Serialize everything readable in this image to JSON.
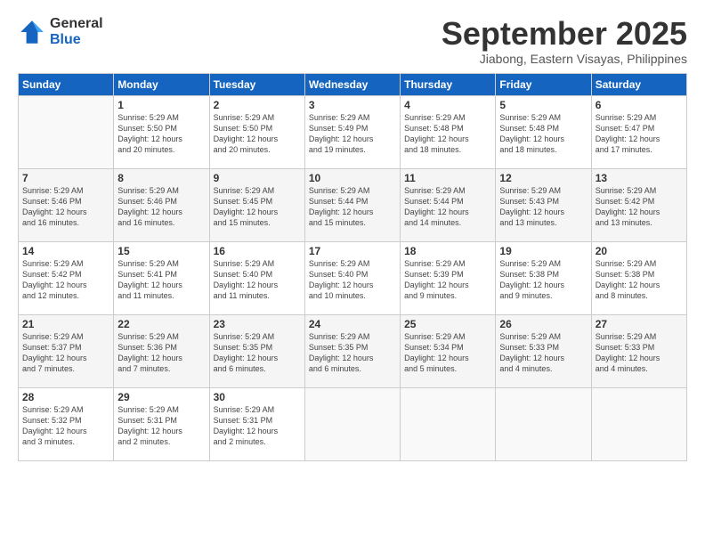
{
  "logo": {
    "general": "General",
    "blue": "Blue"
  },
  "title": "September 2025",
  "location": "Jiabong, Eastern Visayas, Philippines",
  "days_header": [
    "Sunday",
    "Monday",
    "Tuesday",
    "Wednesday",
    "Thursday",
    "Friday",
    "Saturday"
  ],
  "weeks": [
    [
      {
        "num": "",
        "info": ""
      },
      {
        "num": "1",
        "info": "Sunrise: 5:29 AM\nSunset: 5:50 PM\nDaylight: 12 hours\nand 20 minutes."
      },
      {
        "num": "2",
        "info": "Sunrise: 5:29 AM\nSunset: 5:50 PM\nDaylight: 12 hours\nand 20 minutes."
      },
      {
        "num": "3",
        "info": "Sunrise: 5:29 AM\nSunset: 5:49 PM\nDaylight: 12 hours\nand 19 minutes."
      },
      {
        "num": "4",
        "info": "Sunrise: 5:29 AM\nSunset: 5:48 PM\nDaylight: 12 hours\nand 18 minutes."
      },
      {
        "num": "5",
        "info": "Sunrise: 5:29 AM\nSunset: 5:48 PM\nDaylight: 12 hours\nand 18 minutes."
      },
      {
        "num": "6",
        "info": "Sunrise: 5:29 AM\nSunset: 5:47 PM\nDaylight: 12 hours\nand 17 minutes."
      }
    ],
    [
      {
        "num": "7",
        "info": "Sunrise: 5:29 AM\nSunset: 5:46 PM\nDaylight: 12 hours\nand 16 minutes."
      },
      {
        "num": "8",
        "info": "Sunrise: 5:29 AM\nSunset: 5:46 PM\nDaylight: 12 hours\nand 16 minutes."
      },
      {
        "num": "9",
        "info": "Sunrise: 5:29 AM\nSunset: 5:45 PM\nDaylight: 12 hours\nand 15 minutes."
      },
      {
        "num": "10",
        "info": "Sunrise: 5:29 AM\nSunset: 5:44 PM\nDaylight: 12 hours\nand 15 minutes."
      },
      {
        "num": "11",
        "info": "Sunrise: 5:29 AM\nSunset: 5:44 PM\nDaylight: 12 hours\nand 14 minutes."
      },
      {
        "num": "12",
        "info": "Sunrise: 5:29 AM\nSunset: 5:43 PM\nDaylight: 12 hours\nand 13 minutes."
      },
      {
        "num": "13",
        "info": "Sunrise: 5:29 AM\nSunset: 5:42 PM\nDaylight: 12 hours\nand 13 minutes."
      }
    ],
    [
      {
        "num": "14",
        "info": "Sunrise: 5:29 AM\nSunset: 5:42 PM\nDaylight: 12 hours\nand 12 minutes."
      },
      {
        "num": "15",
        "info": "Sunrise: 5:29 AM\nSunset: 5:41 PM\nDaylight: 12 hours\nand 11 minutes."
      },
      {
        "num": "16",
        "info": "Sunrise: 5:29 AM\nSunset: 5:40 PM\nDaylight: 12 hours\nand 11 minutes."
      },
      {
        "num": "17",
        "info": "Sunrise: 5:29 AM\nSunset: 5:40 PM\nDaylight: 12 hours\nand 10 minutes."
      },
      {
        "num": "18",
        "info": "Sunrise: 5:29 AM\nSunset: 5:39 PM\nDaylight: 12 hours\nand 9 minutes."
      },
      {
        "num": "19",
        "info": "Sunrise: 5:29 AM\nSunset: 5:38 PM\nDaylight: 12 hours\nand 9 minutes."
      },
      {
        "num": "20",
        "info": "Sunrise: 5:29 AM\nSunset: 5:38 PM\nDaylight: 12 hours\nand 8 minutes."
      }
    ],
    [
      {
        "num": "21",
        "info": "Sunrise: 5:29 AM\nSunset: 5:37 PM\nDaylight: 12 hours\nand 7 minutes."
      },
      {
        "num": "22",
        "info": "Sunrise: 5:29 AM\nSunset: 5:36 PM\nDaylight: 12 hours\nand 7 minutes."
      },
      {
        "num": "23",
        "info": "Sunrise: 5:29 AM\nSunset: 5:35 PM\nDaylight: 12 hours\nand 6 minutes."
      },
      {
        "num": "24",
        "info": "Sunrise: 5:29 AM\nSunset: 5:35 PM\nDaylight: 12 hours\nand 6 minutes."
      },
      {
        "num": "25",
        "info": "Sunrise: 5:29 AM\nSunset: 5:34 PM\nDaylight: 12 hours\nand 5 minutes."
      },
      {
        "num": "26",
        "info": "Sunrise: 5:29 AM\nSunset: 5:33 PM\nDaylight: 12 hours\nand 4 minutes."
      },
      {
        "num": "27",
        "info": "Sunrise: 5:29 AM\nSunset: 5:33 PM\nDaylight: 12 hours\nand 4 minutes."
      }
    ],
    [
      {
        "num": "28",
        "info": "Sunrise: 5:29 AM\nSunset: 5:32 PM\nDaylight: 12 hours\nand 3 minutes."
      },
      {
        "num": "29",
        "info": "Sunrise: 5:29 AM\nSunset: 5:31 PM\nDaylight: 12 hours\nand 2 minutes."
      },
      {
        "num": "30",
        "info": "Sunrise: 5:29 AM\nSunset: 5:31 PM\nDaylight: 12 hours\nand 2 minutes."
      },
      {
        "num": "",
        "info": ""
      },
      {
        "num": "",
        "info": ""
      },
      {
        "num": "",
        "info": ""
      },
      {
        "num": "",
        "info": ""
      }
    ]
  ]
}
